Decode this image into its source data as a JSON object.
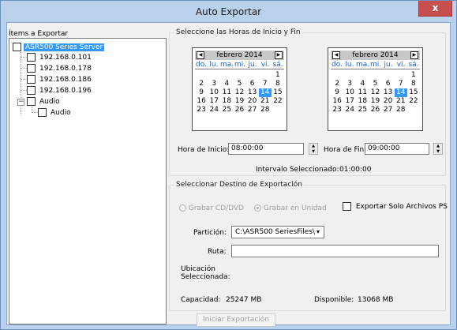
{
  "window": {
    "title": "Auto Exportar",
    "close_glyph": "x"
  },
  "items_group": {
    "legend": "Ítems a Exportar",
    "root_label": "ASR500 Series Server",
    "addresses": [
      "192.168.0.101",
      "192.168.0.178",
      "192.168.0.186",
      "192.168.0.196"
    ],
    "audio_parent": "Audio",
    "audio_child": "Audio"
  },
  "time_group": {
    "legend": "Seleccione las Horas de Inicio y Fin",
    "start_cal": {
      "month": "febrero 2014",
      "days": [
        "do.",
        "lu.",
        "ma.",
        "mi.",
        "ju.",
        "vi.",
        "sá."
      ],
      "weeks": [
        [
          "",
          "",
          "",
          "",
          "",
          "",
          "1"
        ],
        [
          "2",
          "3",
          "4",
          "5",
          "6",
          "7",
          "8"
        ],
        [
          "9",
          "10",
          "11",
          "12",
          "13",
          "14",
          "15"
        ],
        [
          "16",
          "17",
          "18",
          "19",
          "20",
          "21",
          "22"
        ],
        [
          "23",
          "24",
          "25",
          "26",
          "27",
          "28",
          ""
        ]
      ],
      "selected": "14"
    },
    "end_cal": {
      "month": "febrero 2014",
      "days": [
        "do.",
        "lu.",
        "ma.",
        "mi.",
        "ju.",
        "vi.",
        "sá."
      ],
      "weeks": [
        [
          "",
          "",
          "",
          "",
          "",
          "",
          "1"
        ],
        [
          "2",
          "3",
          "4",
          "5",
          "6",
          "7",
          "8"
        ],
        [
          "9",
          "10",
          "11",
          "12",
          "13",
          "14",
          "15"
        ],
        [
          "16",
          "17",
          "18",
          "19",
          "20",
          "21",
          "22"
        ],
        [
          "23",
          "24",
          "25",
          "26",
          "27",
          "28",
          ""
        ]
      ],
      "selected": "14"
    },
    "start_label": "Hora de Inicio:",
    "start_value": "08:00:00",
    "end_label": "Hora de Fin:",
    "end_value": "09:00:00",
    "interval_label": "Intervalo Seleccionado:",
    "interval_value": "01:00:00"
  },
  "dest_group": {
    "legend": "Seleccionar Destino de Exportación",
    "radio_cd": "Grabar CD/DVD",
    "radio_unit": "Grabar en Unidad",
    "export_ps_only": "Exportar Solo Archivos PS",
    "partition_label": "Partición:",
    "partition_value": "C:\\ASR500 SeriesFiles\\",
    "route_label": "Ruta:",
    "route_value": "",
    "location_label_1": "Ubicación",
    "location_label_2": "Seleccionada:",
    "capacity_label": "Capacidad:",
    "capacity_value": "25247 MB",
    "available_label": "Disponible:",
    "available_value": "13068 MB"
  },
  "start_button": "Iniciar Exportación"
}
